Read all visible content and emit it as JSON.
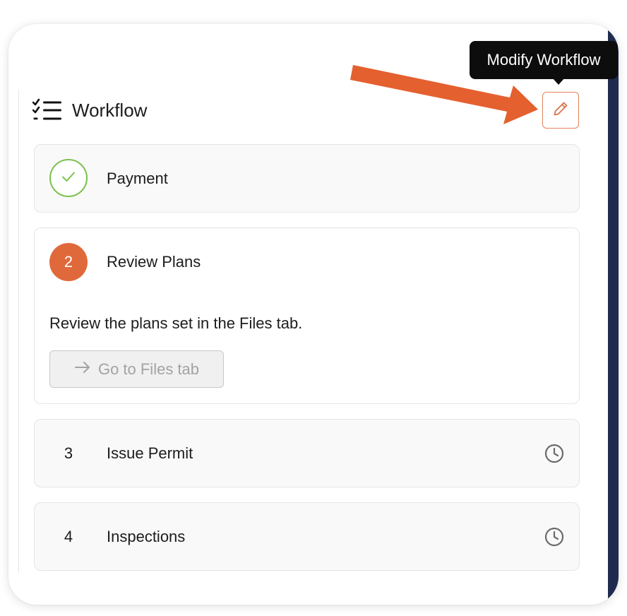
{
  "panel": {
    "title": "Workflow",
    "title_icon": "checklist-icon",
    "edit_icon": "pencil-icon"
  },
  "tooltip": {
    "text": "Modify Workflow"
  },
  "steps": [
    {
      "label": "Payment",
      "status": "complete",
      "icon": "checkmark-icon"
    },
    {
      "number": "2",
      "label": "Review Plans",
      "status": "current",
      "description": "Review the plans set in the Files tab.",
      "action_label": "Go to Files tab",
      "action_icon": "arrow-right-icon"
    },
    {
      "number": "3",
      "label": "Issue Permit",
      "status": "pending",
      "icon": "clock-icon"
    },
    {
      "number": "4",
      "label": "Inspections",
      "status": "pending",
      "icon": "clock-icon"
    }
  ],
  "colors": {
    "accent": "#e0693b",
    "complete": "#7cc24f",
    "navy": "#1f2b4e",
    "annotation_arrow": "#e5602f"
  }
}
